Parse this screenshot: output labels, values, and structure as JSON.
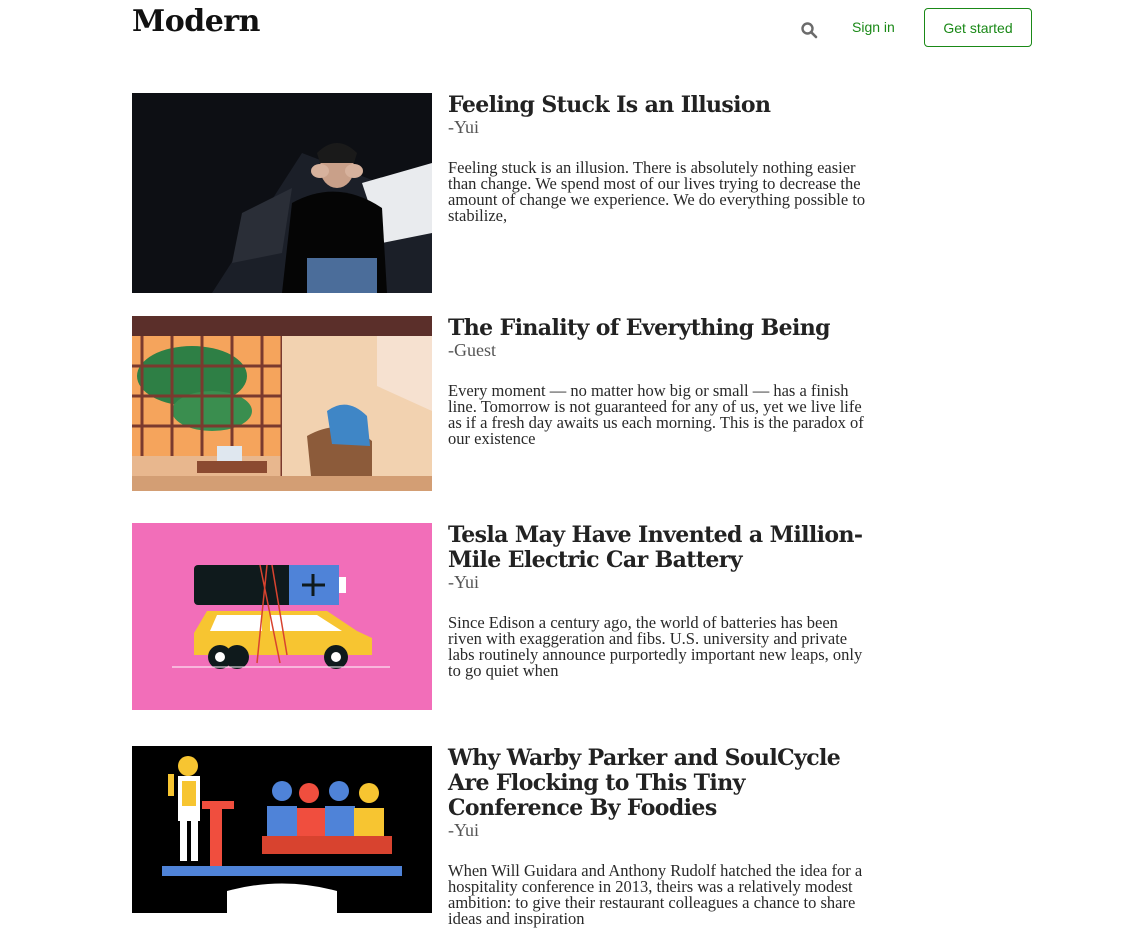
{
  "header": {
    "brand": "Modern",
    "sign_in": "Sign in",
    "get_started": "Get started",
    "search_icon": "search-icon"
  },
  "articles": [
    {
      "title": "Feeling Stuck Is an Illusion",
      "author": "-Yui",
      "excerpt": "Feeling stuck is an illusion. There is absolutely nothing easier than change. We spend most of our lives trying to decrease the amount of change we experience. We do everything possible to stabilize,"
    },
    {
      "title": "The Finality of Everything Being",
      "author": "-Guest",
      "excerpt": "Every moment — no matter how big or small — has a finish line. Tomorrow is not guaranteed for any of us, yet we live life as if a fresh day awaits us each morning. This is the paradox of our existence"
    },
    {
      "title": "Tesla May Have Invented a Million-Mile Electric Car Battery",
      "author": "-Yui",
      "excerpt": "Since Edison a century ago, the world of batteries has been riven with exaggeration and fibs. U.S. university and private labs routinely announce purportedly important new leaps, only to go quiet when"
    },
    {
      "title": "Why Warby Parker and SoulCycle Are Flocking to This Tiny Conference By Foodies",
      "author": "-Yui",
      "excerpt": "When Will Guidara and Anthony Rudolf hatched the idea for a hospitality conference in 2013, theirs was a relatively modest ambition: to give their restaurant colleagues a chance to share ideas and inspiration"
    }
  ]
}
